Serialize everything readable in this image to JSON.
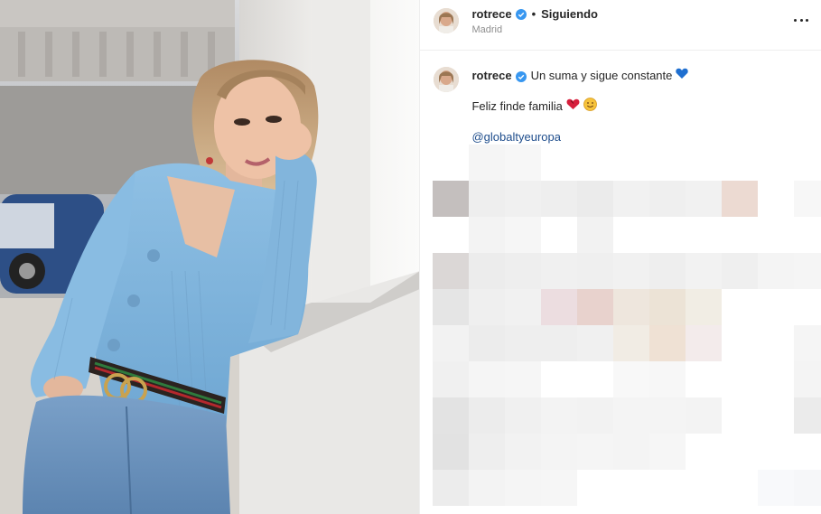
{
  "post": {
    "username": "rotrece",
    "follow_status": "Siguiendo",
    "location": "Madrid",
    "caption": {
      "username": "rotrece",
      "line1": "Un suma y sigue constante",
      "line2": "Feliz finde familia",
      "mention": "@globaltyeuropa"
    }
  },
  "icons": {
    "verified": "verified-badge-icon",
    "more": "more-options-icon",
    "heart_blue": "blue-heart-emoji",
    "heart_red": "red-heart-emoji",
    "smile": "smiling-face-emoji"
  },
  "colors": {
    "verified": "#3897f0",
    "mention": "#1e4d8c",
    "blue_heart": "#1f6fd0",
    "red_heart": "#d61f3c",
    "sweater": "#86b9df"
  }
}
